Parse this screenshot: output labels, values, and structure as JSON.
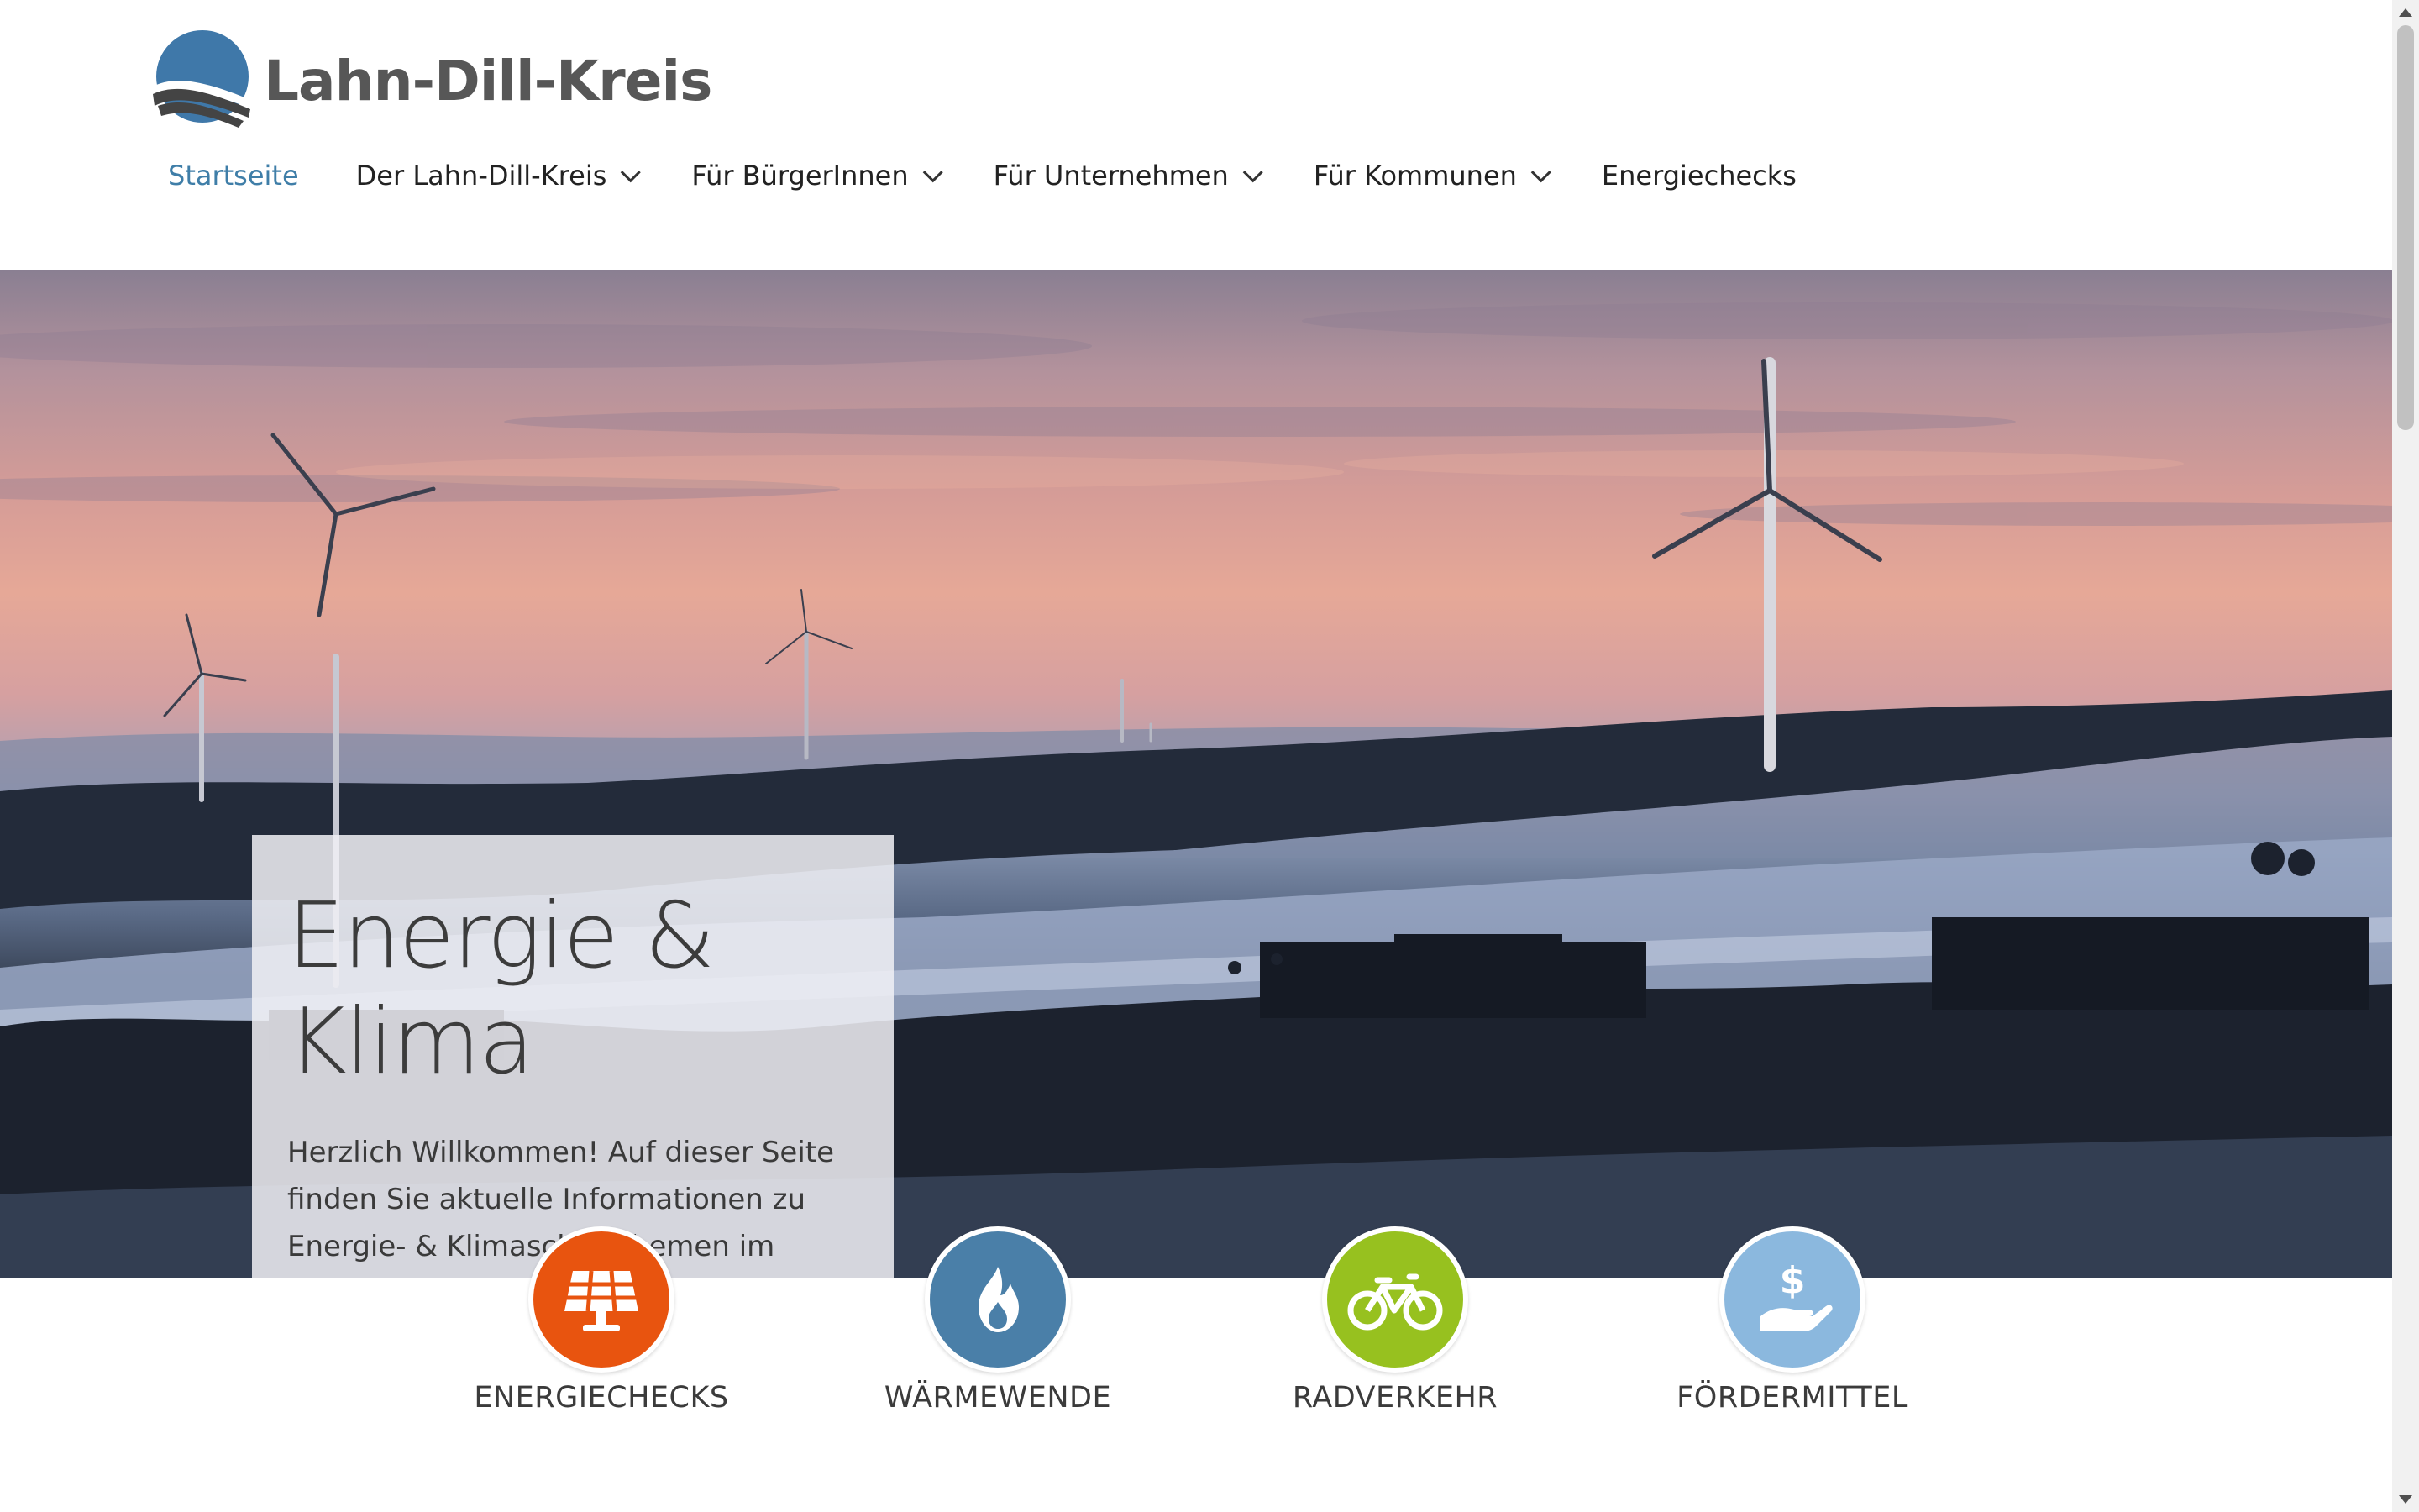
{
  "site": {
    "logo_text": "Lahn-Dill-Kreis",
    "logo_colors": {
      "circle": "#3f78a9",
      "swoosh": "#444444"
    }
  },
  "nav": {
    "items": [
      {
        "label": "Startseite",
        "active": true,
        "has_dropdown": false
      },
      {
        "label": "Der Lahn-Dill-Kreis",
        "active": false,
        "has_dropdown": true
      },
      {
        "label": "Für BürgerInnen",
        "active": false,
        "has_dropdown": true
      },
      {
        "label": "Für Unternehmen",
        "active": false,
        "has_dropdown": true
      },
      {
        "label": "Für Kommunen",
        "active": false,
        "has_dropdown": true
      },
      {
        "label": "Energiechecks",
        "active": false,
        "has_dropdown": false
      }
    ],
    "active_color": "#3f7ea8"
  },
  "hero": {
    "title": "Energie & Klima",
    "text": "Herzlich Willkommen! Auf dieser Seite finden Sie aktuelle Informationen zu Energie- & Klimaschutzthemen im Lahn-Dill-Kreis."
  },
  "topics": [
    {
      "label": "ENERGIECHECKS",
      "icon": "solar-panel-icon",
      "color": "#e8540f"
    },
    {
      "label": "WÄRMEWENDE",
      "icon": "flame-icon",
      "color": "#4a7fa8"
    },
    {
      "label": "RADVERKEHR",
      "icon": "bicycle-icon",
      "color": "#97c11f"
    },
    {
      "label": "FÖRDERMITTEL",
      "icon": "hand-money-icon",
      "color": "#8bb8de"
    }
  ]
}
